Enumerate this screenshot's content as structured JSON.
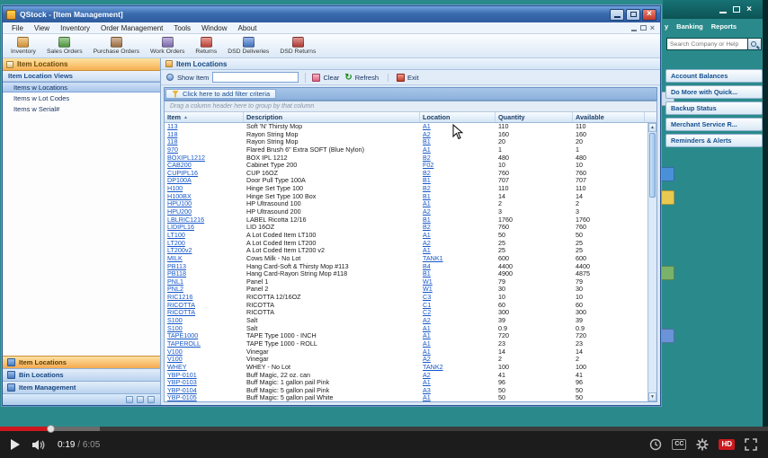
{
  "player": {
    "time_current": "0:19",
    "time_separator": " / ",
    "time_total": "6:05",
    "cc_label": "CC",
    "hd_label": "HD",
    "progress_percent": 6.5,
    "buffer_percent": 13,
    "accent_red": "#cc181e"
  },
  "qb": {
    "menu_fragments": [
      "y",
      "Banking",
      "Reports"
    ],
    "search_placeholder": "Search Company or Help",
    "panel_items": [
      "Account Balances",
      "Do More with Quick...",
      "Backup Status",
      "Merchant Service R...",
      "Reminders & Alerts"
    ]
  },
  "qstock": {
    "title": "QStock - [Item Management]",
    "menus": [
      "File",
      "View",
      "Inventory",
      "Order Management",
      "Tools",
      "Window",
      "About"
    ],
    "toolbar": [
      {
        "label": "Inventory",
        "icon": "inventory-icon",
        "color": "#e8a33d"
      },
      {
        "label": "Sales Orders",
        "icon": "sales-orders-icon",
        "color": "#58a846"
      },
      {
        "label": "Purchase Orders",
        "icon": "purchase-orders-icon",
        "color": "#b07b4a"
      },
      {
        "label": "Work Orders",
        "icon": "work-orders-icon",
        "color": "#8a77c0"
      },
      {
        "label": "Returns",
        "icon": "returns-icon",
        "color": "#d24b3e"
      },
      {
        "label": "DSD Deliveries",
        "icon": "dsd-deliveries-icon",
        "color": "#4a7fd4"
      },
      {
        "label": "DSD Returns",
        "icon": "dsd-returns-icon",
        "color": "#c4413a"
      }
    ],
    "sidebar": {
      "header": "Item Locations",
      "views_header": "Item Location Views",
      "items": [
        {
          "label": "Items w Locations",
          "selected": true
        },
        {
          "label": "Items w Lot Codes",
          "selected": false
        },
        {
          "label": "Items w Serial#",
          "selected": false
        }
      ],
      "nav_buttons": [
        {
          "label": "Item Locations",
          "selected": true
        },
        {
          "label": "Bin Locations",
          "selected": false
        },
        {
          "label": "Item Management",
          "selected": false
        }
      ]
    },
    "main": {
      "header": "Item Locations",
      "show_item_label": "Show Item",
      "show_item_value": "",
      "actions": [
        {
          "label": "Clear",
          "icon": "clear-icon"
        },
        {
          "label": "Refresh",
          "icon": "refresh-icon"
        },
        {
          "label": "Exit",
          "icon": "exit-icon"
        }
      ],
      "filter_button": "Click here to add filter criteria",
      "group_hint": "Drag a column header here to group by that column",
      "columns": [
        "Item",
        "Description",
        "Location",
        "Quantity",
        "Available"
      ],
      "rows": [
        [
          "113",
          "Soft 'N' Thirsty Mop",
          "A1",
          "110",
          "110"
        ],
        [
          "118",
          "Rayon String Mop",
          "A2",
          "160",
          "160"
        ],
        [
          "118",
          "Rayon String Mop",
          "B1",
          "20",
          "20"
        ],
        [
          "970",
          "Flared Brush 6\" Extra SOFT (Blue Nylon)",
          "A1",
          "1",
          "1"
        ],
        [
          "BOXIPL1212",
          "BOX IPL 1212",
          "B2",
          "480",
          "480"
        ],
        [
          "CAB200",
          "Cabinet Type 200",
          "F02",
          "10",
          "10"
        ],
        [
          "CUPIPL16",
          "CUP 16OZ",
          "B2",
          "760",
          "760"
        ],
        [
          "DP100A",
          "Door Pull Type 100A",
          "B1",
          "707",
          "707"
        ],
        [
          "H100",
          "Hinge Set Type 100",
          "B2",
          "110",
          "110"
        ],
        [
          "H100BX",
          "Hinge Set Type 100 Box",
          "B1",
          "14",
          "14"
        ],
        [
          "HPU100",
          "HP Ultrasound 100",
          "A1",
          "2",
          "2"
        ],
        [
          "HPU200",
          "HP Ultrasound 200",
          "A2",
          "3",
          "3"
        ],
        [
          "LBLRIC1216",
          "LABEL Ricotta 12/16",
          "B1",
          "1760",
          "1760"
        ],
        [
          "LIDIPL16",
          "LID 16OZ",
          "B2",
          "760",
          "760"
        ],
        [
          "LT100",
          "A Lot Coded Item LT100",
          "A1",
          "50",
          "50"
        ],
        [
          "LT200",
          "A Lot Coded Item LT200",
          "A2",
          "25",
          "25"
        ],
        [
          "LT200v2",
          "A Lot Coded Item LT200 v2",
          "A1",
          "25",
          "25"
        ],
        [
          "MILK",
          "Cows Milk - No Lot",
          "TANK1",
          "600",
          "600"
        ],
        [
          "PB113",
          "Hang Card-Soft & Thirsty Mop #113",
          "B4",
          "4400",
          "4400"
        ],
        [
          "PB118",
          "Hang Card-Rayon String Mop #118",
          "B1",
          "4900",
          "4875"
        ],
        [
          "PNL1",
          "Panel 1",
          "W1",
          "79",
          "79"
        ],
        [
          "PNL2",
          "Panel 2",
          "W1",
          "30",
          "30"
        ],
        [
          "RIC1216",
          "RICOTTA 12/16OZ",
          "C3",
          "10",
          "10"
        ],
        [
          "RICOTTA",
          "RICOTTA",
          "C1",
          "60",
          "60"
        ],
        [
          "RICOTTA",
          "RICOTTA",
          "C2",
          "300",
          "300"
        ],
        [
          "S100",
          "Salt",
          "A2",
          "39",
          "39"
        ],
        [
          "S100",
          "Salt",
          "A1",
          "0.9",
          "0.9"
        ],
        [
          "TAPE1000",
          "TAPE Type 1000 - INCH",
          "A1",
          "720",
          "720"
        ],
        [
          "TAPEROLL",
          "TAPE Type 1000 - ROLL",
          "A1",
          "23",
          "23"
        ],
        [
          "V100",
          "Vinegar",
          "A1",
          "14",
          "14"
        ],
        [
          "V100",
          "Vinegar",
          "A2",
          "2",
          "2"
        ],
        [
          "WHEY",
          "WHEY - No Lot",
          "TANK2",
          "100",
          "100"
        ],
        [
          "YBP-0101",
          "Buff Magic, 22 oz. can",
          "A2",
          "41",
          "41"
        ],
        [
          "YBP-0103",
          "Buff Magic: 1 gallon pail Pink",
          "A1",
          "96",
          "96"
        ],
        [
          "YBP-0104",
          "Buff Magic: 5 gallon pail Pink",
          "A3",
          "50",
          "50"
        ],
        [
          "YBP-0105",
          "Buff Magic: 5 gallon pail White",
          "A1",
          "50",
          "50"
        ]
      ]
    }
  }
}
